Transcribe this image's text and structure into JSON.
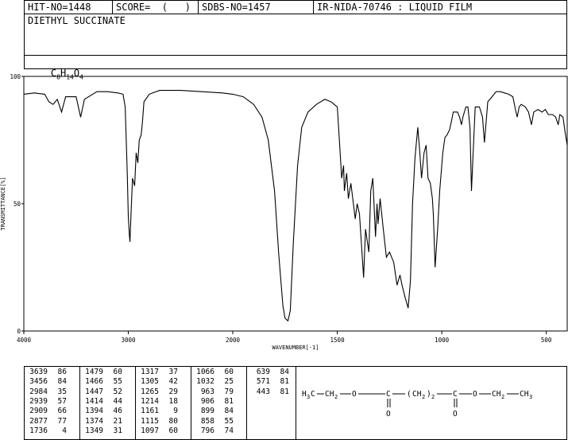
{
  "header": {
    "hit_no": "HIT-NO=1448",
    "score": "SCORE=  (   )",
    "sdbs_no": "SDBS-NO=1457",
    "ir_nida": "IR-NIDA-70746 : LIQUID FILM"
  },
  "compound_name": "DIETHYL SUCCINATE",
  "formula": {
    "c": "C",
    "c_sub": "8",
    "h": "H",
    "h_sub": "14",
    "o": "O",
    "o_sub": "4"
  },
  "chart_data": {
    "type": "line",
    "xlabel": "WAVENUMBER[-1]",
    "ylabel": "TRANSMITTANCE[%]",
    "xlim": [
      4000,
      400
    ],
    "ylim": [
      0,
      100
    ],
    "x_ticks": [
      4000,
      3000,
      2000,
      1500,
      1000,
      500
    ],
    "y_ticks": [
      0,
      50,
      100
    ],
    "x_tick_labels": [
      "4000",
      "3000",
      "2000",
      "1500",
      "1000",
      "500"
    ],
    "y_tick_labels": [
      "0",
      "50",
      "100"
    ],
    "series": [
      {
        "points": [
          [
            4000,
            93
          ],
          [
            3900,
            93.5
          ],
          [
            3800,
            93
          ],
          [
            3760,
            90
          ],
          [
            3720,
            89
          ],
          [
            3680,
            91
          ],
          [
            3639,
            86
          ],
          [
            3600,
            92
          ],
          [
            3500,
            92
          ],
          [
            3456,
            84
          ],
          [
            3420,
            91
          ],
          [
            3300,
            94
          ],
          [
            3200,
            94
          ],
          [
            3100,
            93.5
          ],
          [
            3050,
            93
          ],
          [
            3030,
            88
          ],
          [
            3010,
            62
          ],
          [
            3000,
            45
          ],
          [
            2990,
            38
          ],
          [
            2984,
            35
          ],
          [
            2975,
            45
          ],
          [
            2960,
            60
          ],
          [
            2939,
            57
          ],
          [
            2925,
            70
          ],
          [
            2909,
            66
          ],
          [
            2895,
            75
          ],
          [
            2877,
            77
          ],
          [
            2865,
            82
          ],
          [
            2850,
            90
          ],
          [
            2800,
            93
          ],
          [
            2700,
            94.5
          ],
          [
            2500,
            94.5
          ],
          [
            2300,
            94
          ],
          [
            2100,
            93.5
          ],
          [
            2000,
            93
          ],
          [
            1950,
            92
          ],
          [
            1900,
            89
          ],
          [
            1860,
            84
          ],
          [
            1830,
            75
          ],
          [
            1800,
            55
          ],
          [
            1780,
            30
          ],
          [
            1760,
            10
          ],
          [
            1750,
            5
          ],
          [
            1736,
            4
          ],
          [
            1725,
            8
          ],
          [
            1710,
            35
          ],
          [
            1690,
            65
          ],
          [
            1670,
            80
          ],
          [
            1640,
            86
          ],
          [
            1600,
            89
          ],
          [
            1560,
            91
          ],
          [
            1530,
            90
          ],
          [
            1500,
            88
          ],
          [
            1490,
            75
          ],
          [
            1479,
            60
          ],
          [
            1470,
            65
          ],
          [
            1466,
            55
          ],
          [
            1455,
            62
          ],
          [
            1447,
            52
          ],
          [
            1435,
            58
          ],
          [
            1414,
            44
          ],
          [
            1405,
            50
          ],
          [
            1394,
            46
          ],
          [
            1385,
            35
          ],
          [
            1374,
            21
          ],
          [
            1365,
            40
          ],
          [
            1349,
            31
          ],
          [
            1340,
            55
          ],
          [
            1330,
            60
          ],
          [
            1317,
            37
          ],
          [
            1310,
            50
          ],
          [
            1305,
            42
          ],
          [
            1295,
            52
          ],
          [
            1280,
            40
          ],
          [
            1265,
            29
          ],
          [
            1250,
            31
          ],
          [
            1230,
            27
          ],
          [
            1214,
            18
          ],
          [
            1200,
            22
          ],
          [
            1190,
            18
          ],
          [
            1175,
            13
          ],
          [
            1161,
            9
          ],
          [
            1150,
            20
          ],
          [
            1140,
            50
          ],
          [
            1128,
            68
          ],
          [
            1115,
            80
          ],
          [
            1105,
            70
          ],
          [
            1097,
            60
          ],
          [
            1085,
            70
          ],
          [
            1075,
            73
          ],
          [
            1066,
            60
          ],
          [
            1055,
            58
          ],
          [
            1045,
            52
          ],
          [
            1040,
            45
          ],
          [
            1032,
            25
          ],
          [
            1020,
            40
          ],
          [
            1010,
            55
          ],
          [
            995,
            70
          ],
          [
            985,
            76
          ],
          [
            975,
            77
          ],
          [
            963,
            79
          ],
          [
            955,
            82
          ],
          [
            945,
            86
          ],
          [
            935,
            86
          ],
          [
            925,
            86
          ],
          [
            915,
            84
          ],
          [
            906,
            81
          ],
          [
            899,
            84
          ],
          [
            885,
            88
          ],
          [
            875,
            88
          ],
          [
            865,
            80
          ],
          [
            858,
            55
          ],
          [
            850,
            70
          ],
          [
            840,
            88
          ],
          [
            820,
            88
          ],
          [
            805,
            84
          ],
          [
            796,
            74
          ],
          [
            790,
            80
          ],
          [
            780,
            90
          ],
          [
            760,
            92
          ],
          [
            740,
            94
          ],
          [
            720,
            94
          ],
          [
            700,
            93.5
          ],
          [
            680,
            93
          ],
          [
            660,
            92
          ],
          [
            645,
            86
          ],
          [
            639,
            84
          ],
          [
            630,
            88
          ],
          [
            620,
            89
          ],
          [
            600,
            88
          ],
          [
            585,
            86
          ],
          [
            571,
            81
          ],
          [
            560,
            86
          ],
          [
            540,
            87
          ],
          [
            520,
            86
          ],
          [
            505,
            87
          ],
          [
            490,
            85
          ],
          [
            470,
            85
          ],
          [
            455,
            84
          ],
          [
            443,
            81
          ],
          [
            435,
            85
          ],
          [
            420,
            84
          ],
          [
            410,
            78
          ],
          [
            400,
            73
          ]
        ]
      }
    ]
  },
  "peak_table": {
    "columns": [
      [
        [
          "3639",
          "86"
        ],
        [
          "3456",
          "84"
        ],
        [
          "2984",
          "35"
        ],
        [
          "2939",
          "57"
        ],
        [
          "2909",
          "66"
        ],
        [
          "2877",
          "77"
        ],
        [
          "1736",
          "4"
        ]
      ],
      [
        [
          "1479",
          "60"
        ],
        [
          "1466",
          "55"
        ],
        [
          "1447",
          "52"
        ],
        [
          "1414",
          "44"
        ],
        [
          "1394",
          "46"
        ],
        [
          "1374",
          "21"
        ],
        [
          "1349",
          "31"
        ]
      ],
      [
        [
          "1317",
          "37"
        ],
        [
          "1305",
          "42"
        ],
        [
          "1265",
          "29"
        ],
        [
          "1214",
          "18"
        ],
        [
          "1161",
          "9"
        ],
        [
          "1115",
          "80"
        ],
        [
          "1097",
          "60"
        ]
      ],
      [
        [
          "1066",
          "60"
        ],
        [
          "1032",
          "25"
        ],
        [
          "963",
          "79"
        ],
        [
          "906",
          "81"
        ],
        [
          "899",
          "84"
        ],
        [
          "858",
          "55"
        ],
        [
          "796",
          "74"
        ]
      ],
      [
        [
          "639",
          "84"
        ],
        [
          "571",
          "81"
        ],
        [
          "443",
          "81"
        ]
      ]
    ]
  },
  "structure": {
    "h3c": "H",
    "h3c_sub": "3",
    "h3c_c": "C",
    "ch2a": "CH",
    "ch2a_sub": "2",
    "o1": "O",
    "c1": "C",
    "c1_o": "O",
    "lparen": "(",
    "ch2_mid": "CH",
    "ch2_mid_sub": "2",
    "rparen": ")",
    "paren_sub": "2",
    "c2": "C",
    "c2_o": "O",
    "o2": "O",
    "ch2b": "CH",
    "ch2b_sub": "2",
    "ch3": "CH",
    "ch3_sub": "3"
  }
}
